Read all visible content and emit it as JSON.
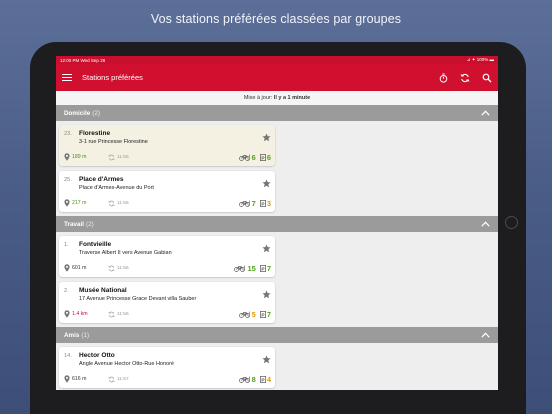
{
  "marketing_caption": "Vos stations préférées classées par groupes",
  "status_bar": {
    "time": "12:00 PM   Wed Sep 28",
    "battery": "⊿ ✦ 100% ▬"
  },
  "app_bar": {
    "title": "Stations préférées"
  },
  "icons": {
    "menu": "menu-icon",
    "timer": "timer-icon",
    "refresh": "refresh-icon",
    "search": "search-icon"
  },
  "colors": {
    "brand": "#d10f2e",
    "group_header": "#9b9b9b",
    "green": "#54a01d",
    "orange": "#e6960c",
    "red": "#c8102e"
  },
  "update": {
    "label": "Mise à jour:",
    "value": "Il y a 1 minute"
  },
  "groups": [
    {
      "name": "Domicile",
      "count": "(2)",
      "stations": [
        {
          "number": "23.",
          "name": "Florestine",
          "address": "3-1 rue Princesse Florestine",
          "distance": "189 m",
          "distance_color": "green",
          "time": "11:55",
          "bikes": "6",
          "bikes_color": "green",
          "docks": "6",
          "docks_color": "green",
          "highlight": true
        },
        {
          "number": "25.",
          "name": "Place d'Armes",
          "address": "Place d'Armes-Avenue du Port",
          "distance": "217 m",
          "distance_color": "green",
          "time": "11:56",
          "bikes": "7",
          "bikes_color": "green",
          "docks": "3",
          "docks_color": "orange",
          "highlight": false
        }
      ]
    },
    {
      "name": "Travail",
      "count": "(2)",
      "stations": [
        {
          "number": "1.",
          "name": "Fontvieille",
          "address": "Traverse Albert II vers Avenue Gabian",
          "distance": "601 m",
          "distance_color": "default",
          "time": "11:56",
          "bikes": "15",
          "bikes_color": "green",
          "docks": "7",
          "docks_color": "green",
          "highlight": false
        },
        {
          "number": "2.",
          "name": "Musée National",
          "address": "17 Avenue Princesse Grace Devant villa Sauber",
          "distance": "1.4 km",
          "distance_color": "red",
          "time": "11:56",
          "bikes": "5",
          "bikes_color": "orange",
          "docks": "7",
          "docks_color": "green",
          "highlight": false
        }
      ]
    },
    {
      "name": "Amis",
      "count": "(1)",
      "stations": [
        {
          "number": "14.",
          "name": "Hector Otto",
          "address": "Angle Avenue Hector Otto-Rue Honoré",
          "distance": "616 m",
          "distance_color": "default",
          "time": "11:57",
          "bikes": "8",
          "bikes_color": "green",
          "docks": "4",
          "docks_color": "orange",
          "highlight": false
        }
      ]
    }
  ]
}
